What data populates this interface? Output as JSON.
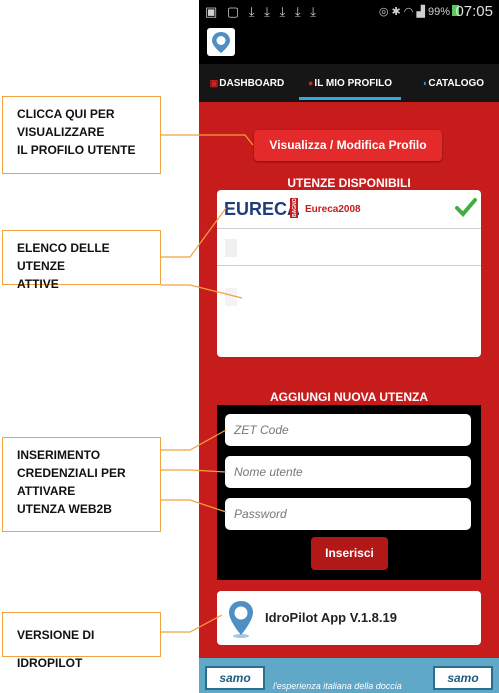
{
  "status_bar": {
    "time": "07:05",
    "battery": "99%",
    "icons": [
      "image-icon",
      "download-icon",
      "download-icon",
      "download-icon",
      "download-icon",
      "download-icon",
      "eye-icon",
      "bluetooth-icon",
      "wifi-icon",
      "signal-icon",
      "battery-icon"
    ]
  },
  "tabs": [
    {
      "label": "DASHBOARD"
    },
    {
      "label": "IL MIO PROFILO",
      "active": true
    },
    {
      "label": "CATALOGO"
    }
  ],
  "profile_button": "Visualizza / Modifica Profilo",
  "users": {
    "title": "UTENZE DISPONIBILI",
    "logo_text": "EURECA",
    "logo_side": "BAGNO",
    "items": [
      {
        "name": "Eureca2008",
        "active": true
      }
    ]
  },
  "add_user": {
    "title": "AGGIUNGI NUOVA UTENZA",
    "zet_placeholder": "ZET Code",
    "username_placeholder": "Nome utente",
    "password_placeholder": "Password",
    "insert_label": "Inserisci"
  },
  "version": "IdroPilot App V.1.8.19",
  "footer": {
    "brand": "samo",
    "tagline": "l'esperienza italiana della doccia"
  },
  "callouts": {
    "profile": [
      "CLICCA QUI PER",
      "VISUALIZZARE",
      "IL PROFILO UTENTE"
    ],
    "users": [
      "ELENCO DELLE UTENZE",
      "ATTIVE"
    ],
    "credentials": [
      "INSERIMENTO",
      "CREDENZIALI PER",
      "ATTIVARE",
      "UTENZA WEB2B"
    ],
    "version": [
      "VERSIONE DI IDROPILOT"
    ]
  },
  "colors": {
    "content_bg": "#c71c1c",
    "button_red": "#e42a2a",
    "tab_indicator": "#33aadd",
    "callout_border": "#f0a340",
    "check_green": "#3fb03f"
  }
}
